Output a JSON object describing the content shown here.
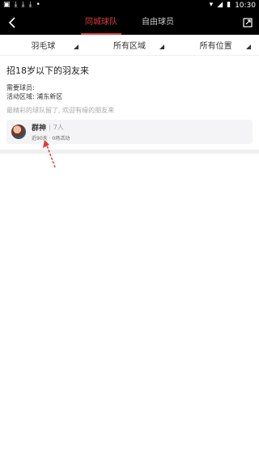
{
  "status_bar": {
    "time": "10:30",
    "colors": {
      "background": "#000000",
      "text": "#ffffff"
    }
  },
  "header": {
    "tabs": [
      {
        "label": "同城球队",
        "active": true
      },
      {
        "label": "自由球员",
        "active": false
      }
    ],
    "accent_color": "#e23b3b"
  },
  "filters": [
    {
      "label": "羽毛球"
    },
    {
      "label": "所有区域"
    },
    {
      "label": "所有位置"
    }
  ],
  "post": {
    "title": "招18岁以下的羽友来",
    "needed_label": "需要球员:",
    "area_line": "活动区域:  浦东新区",
    "note": "最精彩的球队留了, 欢迎有缘的朋友来"
  },
  "team_card": {
    "name": "群神",
    "separator": "|",
    "members": "7人",
    "subtitle": "近90天 · 0场活动"
  },
  "icons": {
    "back": "chevron-left-icon",
    "share": "share-icon",
    "dropdown": "triangle-corner-icon"
  }
}
